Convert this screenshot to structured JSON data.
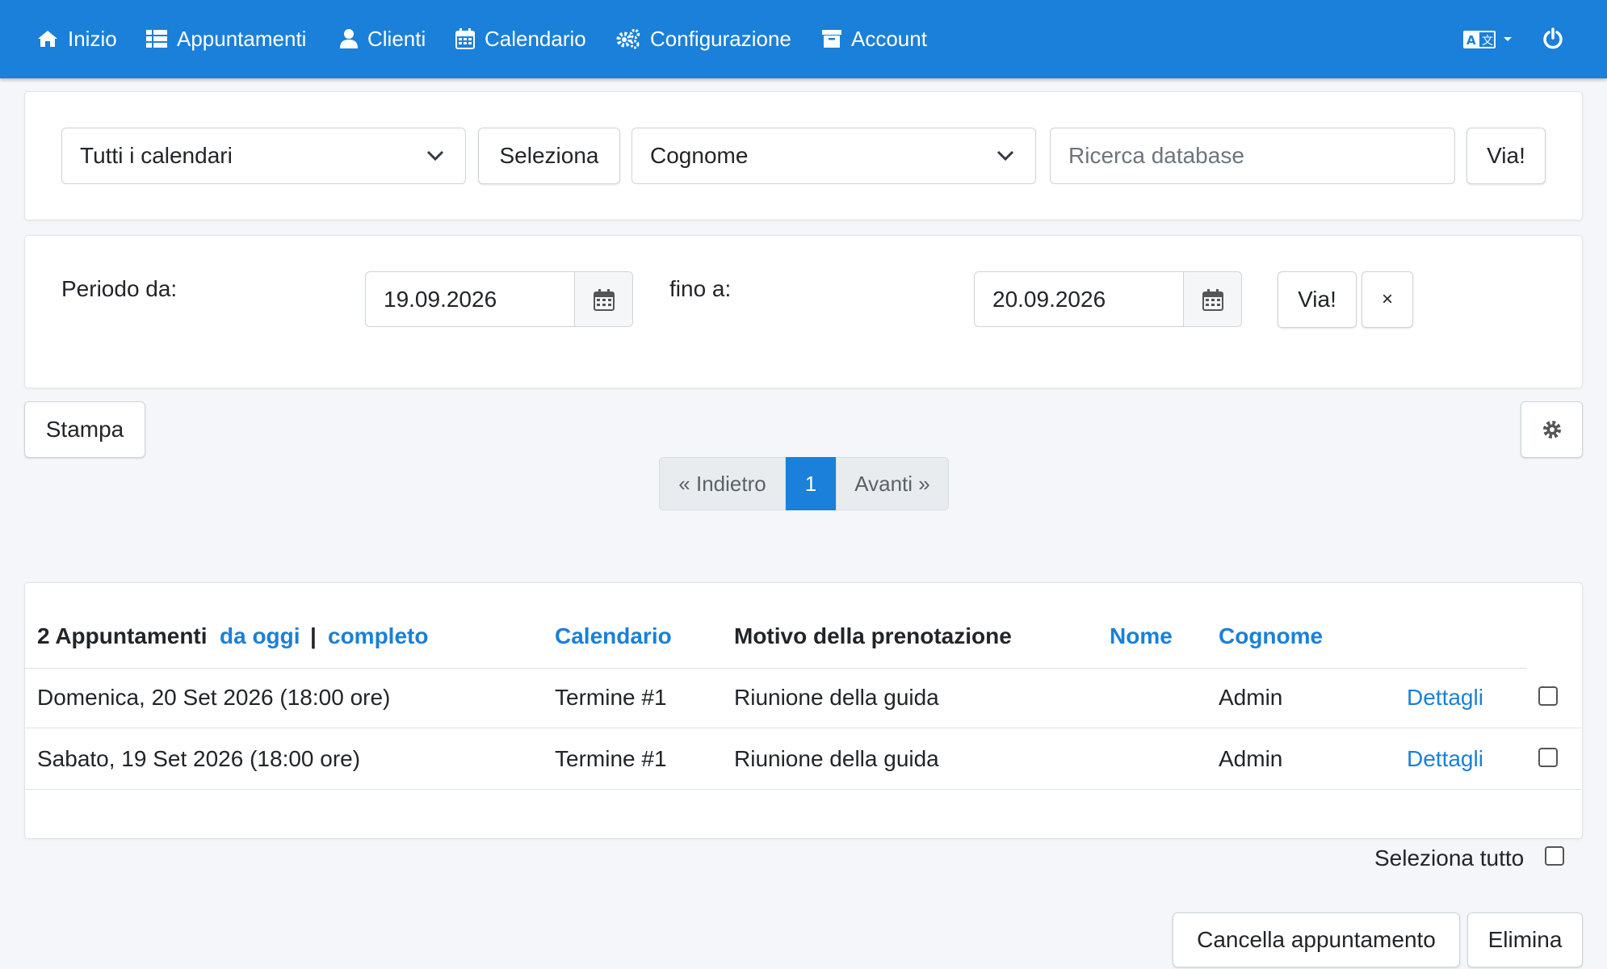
{
  "nav": {
    "items": [
      {
        "label": "Inizio",
        "icon": "home-icon"
      },
      {
        "label": "Appuntamenti",
        "icon": "list-icon"
      },
      {
        "label": "Clienti",
        "icon": "user-icon"
      },
      {
        "label": "Calendario",
        "icon": "calendar-icon"
      },
      {
        "label": "Configurazione",
        "icon": "cogs-icon"
      },
      {
        "label": "Account",
        "icon": "archive-icon"
      }
    ],
    "language_icon": "language-icon",
    "power_icon": "power-icon"
  },
  "search": {
    "calendar_select": "Tutti i calendari",
    "select_button": "Seleziona",
    "field_select": "Cognome",
    "search_placeholder": "Ricerca database",
    "go_button": "Via!"
  },
  "period": {
    "from_label": "Periodo da:",
    "from_value": "19.09.2026",
    "to_label": "fino a:",
    "to_value": "20.09.2026",
    "go_button": "Via!",
    "clear_button": "×"
  },
  "toolbar": {
    "print_button": "Stampa",
    "settings_icon": "gear-icon"
  },
  "pagination": {
    "prev": "« Indietro",
    "current": "1",
    "next": "Avanti »"
  },
  "table": {
    "count_label": "2 Appuntamenti",
    "from_today_link": "da oggi",
    "separator": "|",
    "complete_link": "completo",
    "headers": {
      "calendar": "Calendario",
      "reason": "Motivo della prenotazione",
      "first_name": "Nome",
      "last_name": "Cognome"
    },
    "rows": [
      {
        "date": "Domenica, 20 Set 2026 (18:00 ore)",
        "calendar": "Termine #1",
        "reason": "Riunione della guida",
        "last_name": "Admin",
        "details": "Dettagli"
      },
      {
        "date": "Sabato, 19 Set 2026 (18:00 ore)",
        "calendar": "Termine #1",
        "reason": "Riunione della guida",
        "last_name": "Admin",
        "details": "Dettagli"
      }
    ]
  },
  "footer": {
    "select_all_label": "Seleziona tutto",
    "cancel_button": "Cancella appuntamento",
    "delete_button": "Elimina"
  },
  "colors": {
    "primary": "#1a80d9",
    "background": "#f4f6f9"
  }
}
